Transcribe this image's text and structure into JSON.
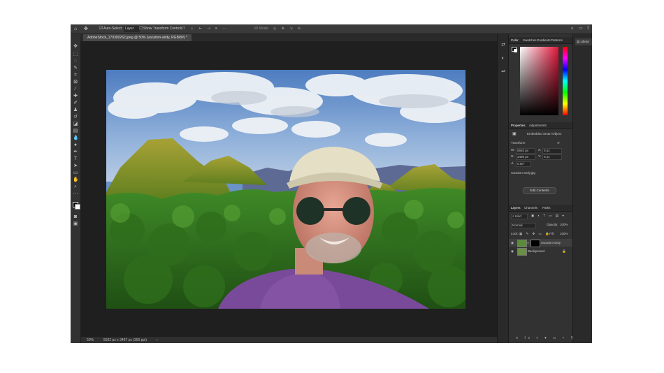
{
  "options_bar": {
    "auto_select_label": "Auto-Select:",
    "auto_select_value": "Layer",
    "transform_label": "Show Transform Controls",
    "mode_3d": "3D Mode:"
  },
  "document": {
    "tab_title": "AdobeStock_179300262.jpeg @ 50% (vacation-andy, RGB/8#) *"
  },
  "status": {
    "zoom": "50%",
    "dimensions": "5592 px x 3497 px (300 ppi)"
  },
  "color_panel": {
    "tabs": [
      "Color",
      "Swatches",
      "Gradients",
      "Patterns"
    ]
  },
  "properties_panel": {
    "tabs": [
      "Properties",
      "Adjustments"
    ],
    "layer_kind": "Embedded Smart Object",
    "section_title": "Transform",
    "w_value": "5592 px",
    "h_value": "3496 px",
    "x_value": "0 px",
    "y_value": "0 px",
    "angle_value": "0.00°",
    "file_name": "vacation-andy.jpg",
    "edit_button": "Edit Contents"
  },
  "layers_panel": {
    "tabs": [
      "Layers",
      "Channels",
      "Paths"
    ],
    "filter_kind": "Kind",
    "blend_mode": "Normal",
    "opacity_label": "Opacity:",
    "opacity_value": "100%",
    "lock_label": "Lock:",
    "fill_label": "Fill:",
    "fill_value": "100%",
    "layers": [
      {
        "name": "vacation-andy"
      },
      {
        "name": "Background"
      }
    ]
  },
  "right_panel": {
    "tab": "Librari"
  },
  "icons": {
    "home": "home-icon",
    "move": "move-icon",
    "search": "search-icon"
  },
  "colors": {
    "accent": "#2c2c2c",
    "panel": "#323232",
    "canvas": "#1f1f1f"
  }
}
